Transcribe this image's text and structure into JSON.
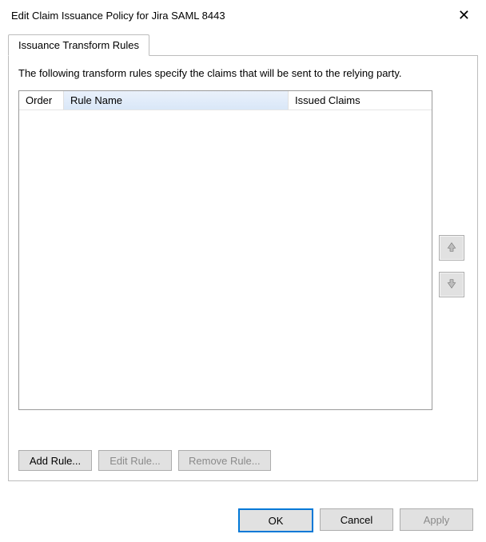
{
  "dialog": {
    "title": "Edit Claim Issuance Policy for Jira SAML 8443"
  },
  "tabs": {
    "active": "Issuance Transform Rules"
  },
  "description": "The following transform rules specify the claims that will be sent to the relying party.",
  "columns": {
    "order": "Order",
    "name": "Rule Name",
    "claims": "Issued Claims"
  },
  "ruleButtons": {
    "add": "Add Rule...",
    "edit": "Edit Rule...",
    "remove": "Remove Rule..."
  },
  "dialogButtons": {
    "ok": "OK",
    "cancel": "Cancel",
    "apply": "Apply"
  }
}
